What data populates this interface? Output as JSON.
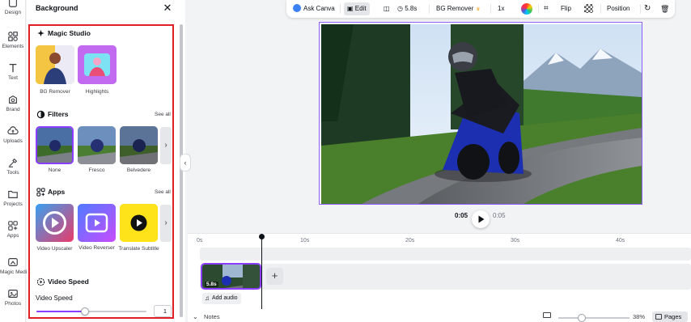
{
  "rail": {
    "items": [
      {
        "label": "Design",
        "icon": "design-icon"
      },
      {
        "label": "Elements",
        "icon": "elements-icon"
      },
      {
        "label": "Text",
        "icon": "text-icon"
      },
      {
        "label": "Brand",
        "icon": "brand-icon"
      },
      {
        "label": "Uploads",
        "icon": "uploads-icon"
      },
      {
        "label": "Tools",
        "icon": "tools-icon"
      },
      {
        "label": "Projects",
        "icon": "projects-icon"
      },
      {
        "label": "Apps",
        "icon": "apps-icon"
      },
      {
        "label": "Magic Media",
        "icon": "magic-media-icon"
      },
      {
        "label": "Photos",
        "icon": "photos-icon"
      }
    ]
  },
  "panel": {
    "title": "Background",
    "magic_studio": {
      "title": "Magic Studio",
      "items": [
        {
          "label": "BG Remover"
        },
        {
          "label": "Highlights"
        }
      ]
    },
    "filters": {
      "title": "Filters",
      "see_all": "See all",
      "items": [
        {
          "label": "None"
        },
        {
          "label": "Fresco"
        },
        {
          "label": "Belvedere"
        }
      ]
    },
    "apps": {
      "title": "Apps",
      "see_all": "See all",
      "items": [
        {
          "label": "Video Upscaler"
        },
        {
          "label": "Video Reverser"
        },
        {
          "label": "Translate Subtitle"
        }
      ]
    },
    "video_speed": {
      "title": "Video Speed",
      "label": "Video Speed",
      "value": "1",
      "slider_fraction": 0.44
    }
  },
  "toolbar": {
    "ask_canva": "Ask Canva",
    "edit": "Edit",
    "duration": "5.8s",
    "bg_remover": "BG Remover",
    "speed": "1x",
    "flip": "Flip",
    "position": "Position"
  },
  "player": {
    "current_time": "0:05",
    "total_time": "0:05"
  },
  "timeline": {
    "ticks": [
      "0s",
      "10s",
      "20s",
      "30s",
      "40s"
    ],
    "clip_duration": "5.8s",
    "add_audio": "Add audio"
  },
  "bottombar": {
    "notes": "Notes",
    "zoom": "38%",
    "pages": "Pages"
  },
  "colors": {
    "accent": "#8b3dff",
    "highlight_box": "#e01e26"
  }
}
